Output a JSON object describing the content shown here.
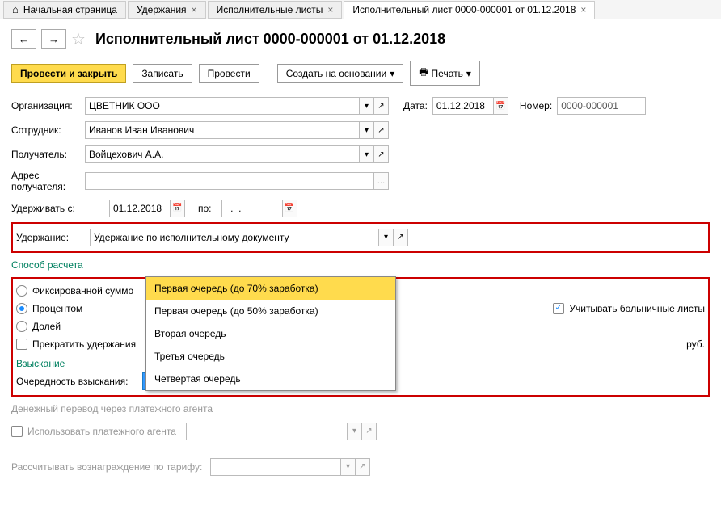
{
  "tabs": {
    "home": "Начальная страница",
    "tab1": "Удержания",
    "tab2": "Исполнительные листы",
    "tab3": "Исполнительный лист 0000-000001 от 01.12.2018"
  },
  "title": "Исполнительный лист 0000-000001 от 01.12.2018",
  "toolbar": {
    "post_close": "Провести и закрыть",
    "save": "Записать",
    "post": "Провести",
    "create_based": "Создать на основании",
    "print": "Печать"
  },
  "labels": {
    "org": "Организация:",
    "date": "Дата:",
    "number": "Номер:",
    "employee": "Сотрудник:",
    "recipient": "Получатель:",
    "address": "Адрес получателя:",
    "hold_from": "Удерживать с:",
    "to": "по:",
    "deduction": "Удержание:",
    "calc_method": "Способ расчета",
    "fixed": "Фиксированной суммо",
    "percent": "Процентом",
    "share": "Долей",
    "stop": "Прекратить удержания",
    "sick": "Учитывать больничные листы",
    "rub": "руб.",
    "collection": "Взыскание",
    "priority": "Очередность взыскания:",
    "priority_value": "Первая очередь (до 70% заработка)",
    "transfer": "Денежный перевод через платежного агента",
    "use_agent": "Использовать платежного агента",
    "reward": "Рассчитывать вознаграждение по тарифу:"
  },
  "values": {
    "org": "ЦВЕТНИК ООО",
    "date": "01.12.2018",
    "number": "0000-000001",
    "employee": "Иванов Иван Иванович",
    "recipient": "Войцехович А.А.",
    "hold_from": "01.12.2018",
    "to": "  .  .    ",
    "deduction": "Удержание по исполнительному документу"
  },
  "dropdown": {
    "opt1": "Первая очередь (до 70% заработка)",
    "opt2": "Первая очередь (до 50% заработка)",
    "opt3": "Вторая очередь",
    "opt4": "Третья очередь",
    "opt5": "Четвертая очередь"
  }
}
